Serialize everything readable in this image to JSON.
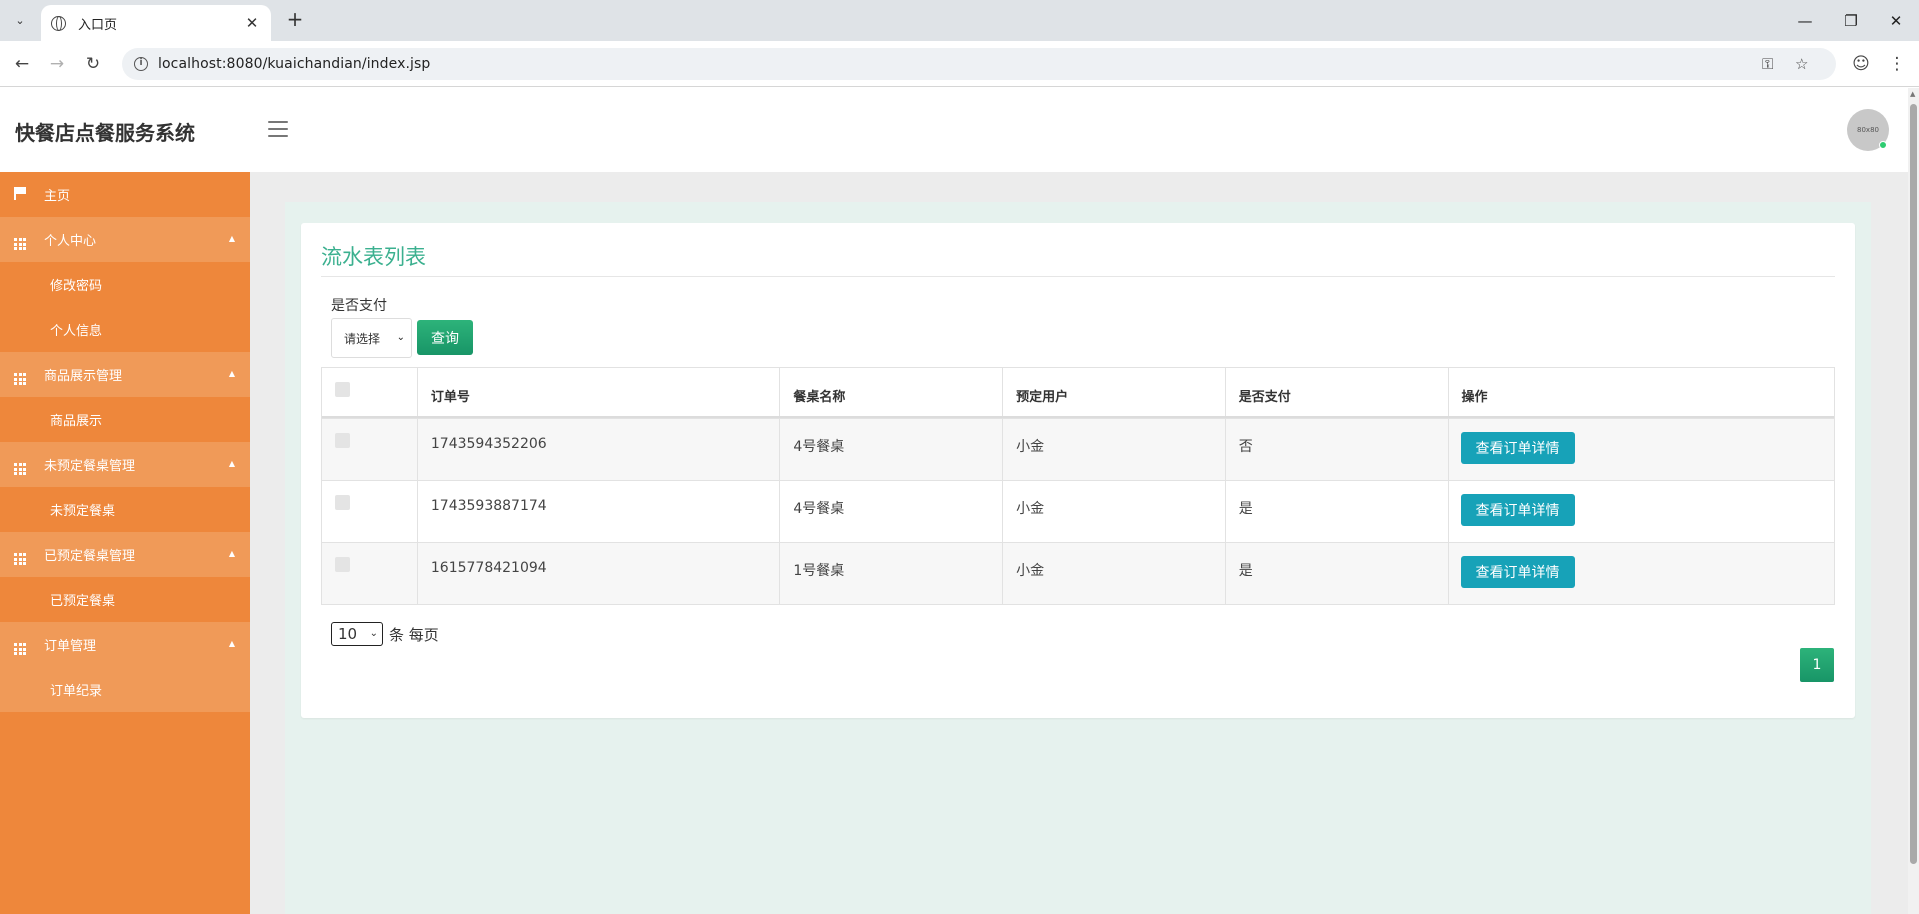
{
  "browser": {
    "tab_title": "入口页",
    "url": "localhost:8080/kuaichandian/index.jsp",
    "icons": [
      "tab-search-icon",
      "globe-icon",
      "close-icon",
      "plus-icon",
      "minimize-icon",
      "restore-icon",
      "close-window-icon",
      "back-icon",
      "forward-icon",
      "reload-icon",
      "info-icon",
      "key-icon",
      "star-icon",
      "profile-icon",
      "menu-dots-icon"
    ]
  },
  "header": {
    "brand": "快餐店点餐服务系统",
    "avatar_text": "80x80"
  },
  "sidebar": {
    "home": "主页",
    "groups": [
      {
        "label": "个人中心",
        "items": [
          "修改密码",
          "个人信息"
        ]
      },
      {
        "label": "商品展示管理",
        "items": [
          "商品展示"
        ]
      },
      {
        "label": "未预定餐桌管理",
        "items": [
          "未预定餐桌"
        ]
      },
      {
        "label": "已预定餐桌管理",
        "items": [
          "已预定餐桌"
        ]
      },
      {
        "label": "订单管理",
        "items": [
          "订单纪录"
        ]
      }
    ]
  },
  "main": {
    "title": "流水表列表",
    "filter": {
      "label": "是否支付",
      "select_value": "请选择",
      "query_label": "查询"
    },
    "table": {
      "headers": [
        "订单号",
        "餐桌名称",
        "预定用户",
        "是否支付",
        "操作"
      ],
      "rows": [
        {
          "order_no": "1743594352206",
          "table_name": "4号餐桌",
          "user": "小金",
          "paid": "否",
          "action": "查看订单详情"
        },
        {
          "order_no": "1743593887174",
          "table_name": "4号餐桌",
          "user": "小金",
          "paid": "是",
          "action": "查看订单详情"
        },
        {
          "order_no": "1615778421094",
          "table_name": "1号餐桌",
          "user": "小金",
          "paid": "是",
          "action": "查看订单详情"
        }
      ]
    },
    "pagination": {
      "page_size": "10",
      "page_size_suffix": "条 每页",
      "current_page": "1"
    }
  },
  "colors": {
    "sidebar": "#ee873b",
    "sidebar_group": "#f09a58",
    "title": "#3bb08f",
    "primary_button": "#189567",
    "detail_button": "#17a2b8"
  }
}
